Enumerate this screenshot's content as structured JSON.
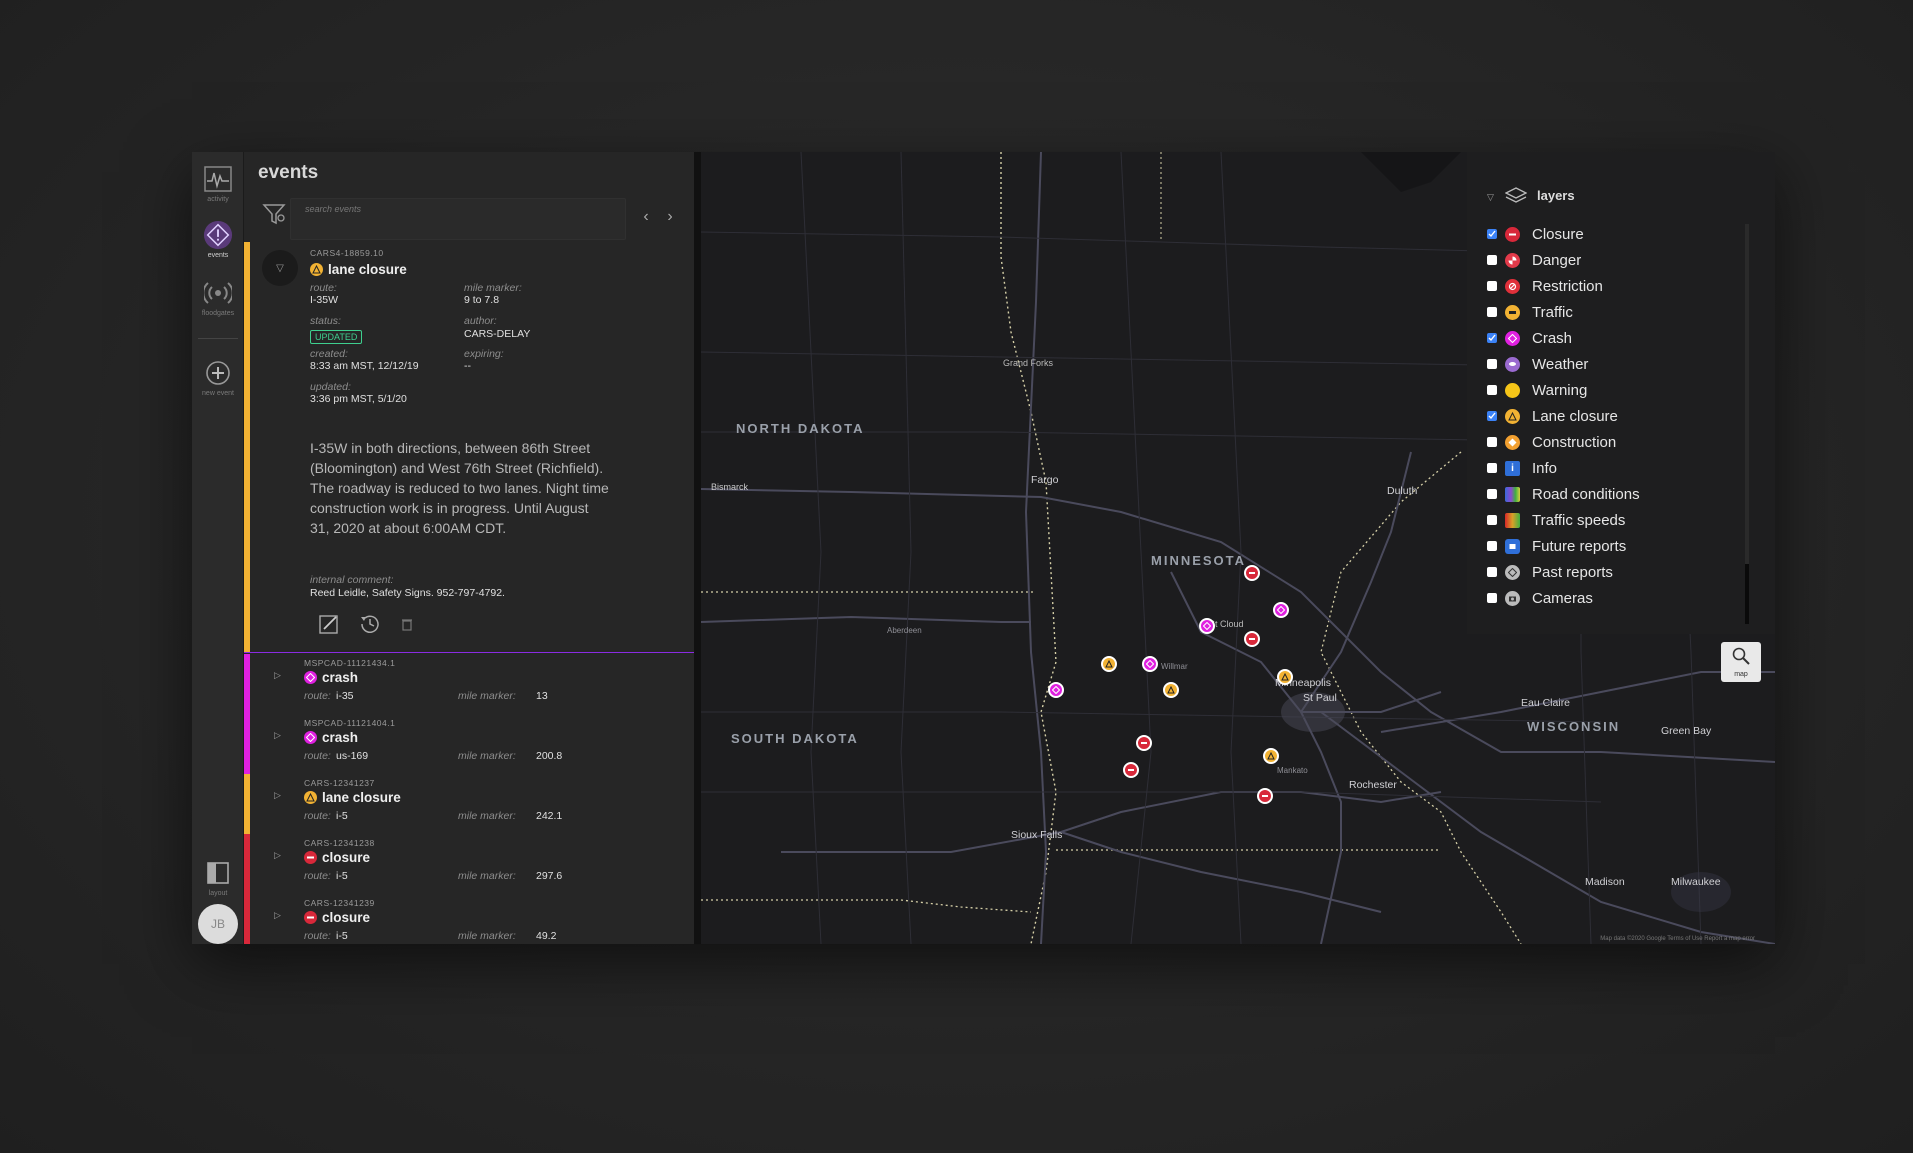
{
  "rail": {
    "items": [
      {
        "label": "activity",
        "icon": "activity-icon"
      },
      {
        "label": "events",
        "icon": "events-icon"
      },
      {
        "label": "floodgates",
        "icon": "floodgates-icon"
      },
      {
        "label": "new event",
        "icon": "plus-icon"
      },
      {
        "label": "layout",
        "icon": "layout-icon"
      }
    ],
    "avatar": "JB"
  },
  "panel": {
    "title": "events",
    "search_placeholder": "search events"
  },
  "expanded_event": {
    "id": "CARS4-18859.10",
    "title": "lane closure",
    "route_label": "route:",
    "route": "I-35W",
    "mile_label": "mile marker:",
    "mile": "9 to 7.8",
    "status_label": "status:",
    "status": "UPDATED",
    "author_label": "author:",
    "author": "CARS-DELAY",
    "created_label": "created:",
    "created": "8:33 am MST, 12/12/19",
    "expiring_label": "expiring:",
    "expiring": "--",
    "updated_label": "updated:",
    "updated": "3:36 pm MST, 5/1/20",
    "description": "I-35W in both directions, between 86th Street (Bloomington) and West 76th Street (Richfield). The roadway is reduced to two lanes. Night time construction work is in progress. Until August 31, 2020 at about 6:00AM CDT.",
    "comment_label": "internal comment:",
    "comment": "Reed Leidle, Safety Signs. 952-797-4792.",
    "color": "#f2b233"
  },
  "events": [
    {
      "id": "MSPCAD-11121434.1",
      "title": "crash",
      "route": "i-35",
      "mile": "13",
      "color": "#e020e0",
      "type": "crash"
    },
    {
      "id": "MSPCAD-11121404.1",
      "title": "crash",
      "route": "us-169",
      "mile": "200.8",
      "color": "#e020e0",
      "type": "crash"
    },
    {
      "id": "CARS-12341237",
      "title": "lane closure",
      "route": "i-5",
      "mile": "242.1",
      "color": "#f2b233",
      "type": "lane"
    },
    {
      "id": "CARS-12341238",
      "title": "closure",
      "route": "i-5",
      "mile": "297.6",
      "color": "#d8283a",
      "type": "closure"
    },
    {
      "id": "CARS-12341239",
      "title": "closure",
      "route": "i-5",
      "mile": "49.2",
      "color": "#d8283a",
      "type": "closure"
    }
  ],
  "labels": {
    "route": "route:",
    "mile": "mile marker:"
  },
  "layers": {
    "title": "layers",
    "items": [
      {
        "label": "Closure",
        "checked": true,
        "icon": "closure-icon",
        "color": "#d8283a"
      },
      {
        "label": "Danger",
        "checked": false,
        "icon": "danger-icon",
        "color": "#e23a4a"
      },
      {
        "label": "Restriction",
        "checked": false,
        "icon": "restriction-icon",
        "color": "#e0303a"
      },
      {
        "label": "Traffic",
        "checked": false,
        "icon": "traffic-icon",
        "color": "#f2b233"
      },
      {
        "label": "Crash",
        "checked": true,
        "icon": "crash-icon",
        "color": "#e020e0"
      },
      {
        "label": "Weather",
        "checked": false,
        "icon": "weather-icon",
        "color": "#9a6ad0"
      },
      {
        "label": "Warning",
        "checked": false,
        "icon": "warning-icon",
        "color": "#f5c518"
      },
      {
        "label": "Lane closure",
        "checked": true,
        "icon": "lane-closure-icon",
        "color": "#f2b233"
      },
      {
        "label": "Construction",
        "checked": false,
        "icon": "construction-icon",
        "color": "#f2a030"
      },
      {
        "label": "Info",
        "checked": false,
        "icon": "info-icon",
        "color": "#2f6fd8"
      },
      {
        "label": "Road conditions",
        "checked": false,
        "icon": "road-conditions-icon",
        "color": "#8a4ad0"
      },
      {
        "label": "Traffic speeds",
        "checked": false,
        "icon": "traffic-speeds-icon",
        "color": "#40b040"
      },
      {
        "label": "Future reports",
        "checked": false,
        "icon": "future-reports-icon",
        "color": "#2f6fd8"
      },
      {
        "label": "Past reports",
        "checked": false,
        "icon": "past-reports-icon",
        "color": "#bbbbbb"
      },
      {
        "label": "Cameras",
        "checked": false,
        "icon": "camera-icon",
        "color": "#bbbbbb"
      }
    ]
  },
  "map": {
    "zoom_label": "map",
    "states": [
      "NORTH DAKOTA",
      "MINNESOTA",
      "SOUTH DAKOTA",
      "WISCONSIN"
    ],
    "cities": [
      "Minneapolis",
      "St Paul",
      "Rochester",
      "Duluth",
      "Fargo",
      "Sioux Falls",
      "Madison",
      "Milwaukee",
      "Green Bay",
      "Eau Claire",
      "St Cloud",
      "Mankato",
      "Bismarck",
      "Aberdeen",
      "Grand Forks",
      "Willmar"
    ],
    "attribution": "Map data ©2020 Google   Terms of Use   Report a map error"
  }
}
